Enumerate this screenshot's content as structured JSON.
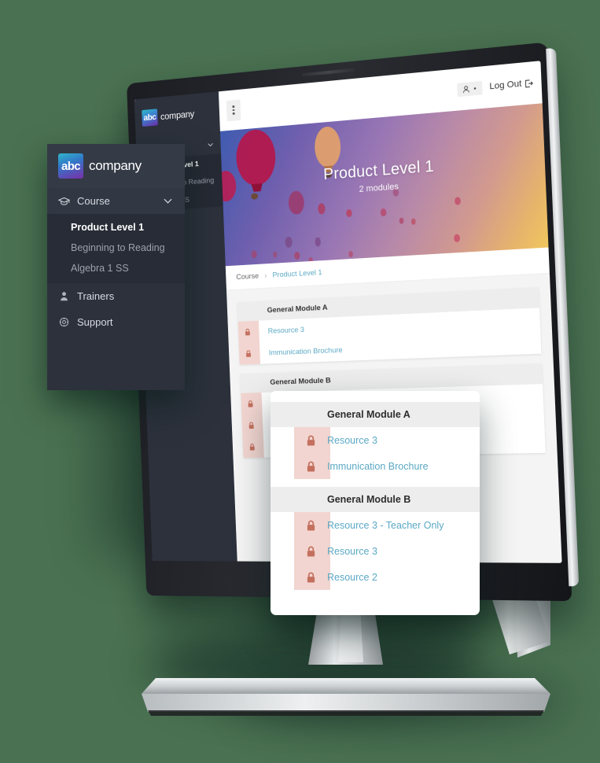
{
  "brand": {
    "badge_text": "abc",
    "word": "company"
  },
  "topbar": {
    "menu_icon": "kebab-menu-icon",
    "user_icon": "user-icon",
    "logout_label": "Log Out",
    "logout_icon": "exit-icon"
  },
  "sidebar": {
    "course": {
      "label": "Course",
      "icon": "graduation-cap-icon",
      "chevron": "chevron-down-icon"
    },
    "courses": [
      {
        "label": "Product Level 1",
        "active": true
      },
      {
        "label": "Beginning to Reading",
        "active": false
      },
      {
        "label": "Algebra 1 SS",
        "active": false
      }
    ],
    "links": [
      {
        "label": "Trainers",
        "icon": "user-icon"
      },
      {
        "label": "Support",
        "icon": "gear-icon"
      }
    ]
  },
  "hero": {
    "title": "Product Level 1",
    "subtitle": "2 modules"
  },
  "breadcrumb": {
    "root": "Course",
    "separator": "›",
    "current": "Product Level 1"
  },
  "modules": [
    {
      "title": "General Module A",
      "items": [
        {
          "label": "Resource 3",
          "locked": true
        },
        {
          "label": "Immunication Brochure",
          "locked": true
        }
      ]
    },
    {
      "title": "General Module B",
      "items": [
        {
          "label": "Resource 3 - Teacher Only",
          "locked": true
        },
        {
          "label": "Resource 3",
          "locked": true
        },
        {
          "label": "Resource 2",
          "locked": true
        }
      ]
    }
  ],
  "colors": {
    "page_background": "#4a7151",
    "sidebar": "#2c313c",
    "sidebar_sub": "#272c36",
    "link": "#5ba9c4",
    "lock_column": "#f2d5d0",
    "lock_icon": "#c4705f",
    "module_header": "#ededed"
  }
}
